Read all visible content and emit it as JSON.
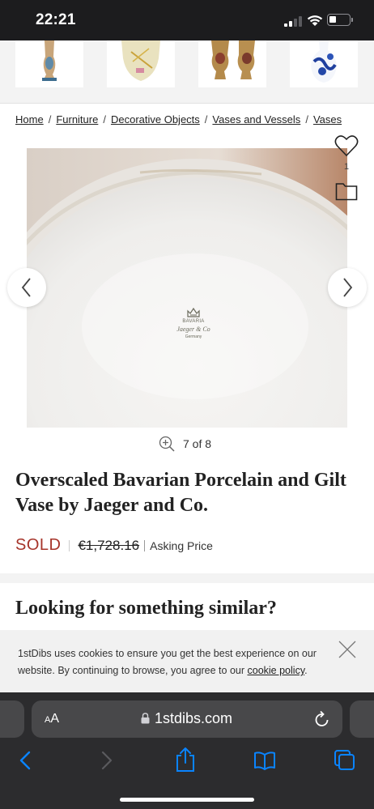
{
  "status": {
    "time": "22:21"
  },
  "breadcrumb": [
    {
      "label": "Home"
    },
    {
      "label": "Furniture"
    },
    {
      "label": "Decorative Objects"
    },
    {
      "label": "Vases and Vessels"
    },
    {
      "label": "Vases"
    }
  ],
  "gallery": {
    "counter": "7 of 8",
    "favorites_count": "1",
    "backstamp": {
      "brand": "BAVARIA",
      "script": "Jaeger & Co",
      "country": "Germany"
    }
  },
  "product": {
    "title": "Overscaled Bavarian Porcelain and Gilt Vase by Jaeger and Co.",
    "status": "SOLD",
    "price": "€1,728.16",
    "price_note": "Asking Price"
  },
  "similar": {
    "heading": "Looking for something similar?"
  },
  "cookie": {
    "text_before": "1stDibs uses cookies to ensure you get the best experience on our website. By continuing to browse, you agree to our ",
    "link": "cookie policy",
    "text_after": "."
  },
  "browser": {
    "text_size_label_small": "A",
    "text_size_label_large": "A",
    "url": "1stdibs.com"
  },
  "colors": {
    "sold": "#a6342a",
    "ios_blue": "#0a84ff"
  }
}
